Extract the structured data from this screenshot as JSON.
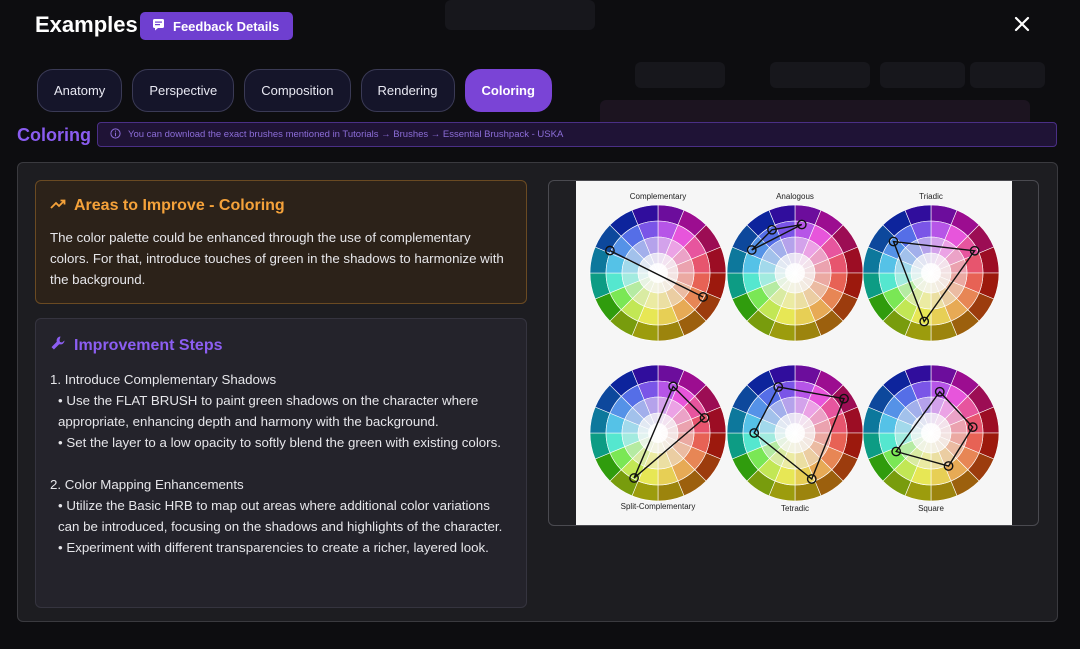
{
  "header": {
    "title": "Examples",
    "feedback_label": "Feedback Details",
    "close_icon": "close-icon"
  },
  "tabs": [
    {
      "label": "Anatomy",
      "active": false
    },
    {
      "label": "Perspective",
      "active": false
    },
    {
      "label": "Composition",
      "active": false
    },
    {
      "label": "Rendering",
      "active": false
    },
    {
      "label": "Coloring",
      "active": true
    }
  ],
  "section": {
    "title": "Coloring",
    "info": "You can download the exact brushes mentioned in Tutorials → Brushes → Essential Brushpack - USKA"
  },
  "improve": {
    "title": "Areas to Improve - Coloring",
    "body": "The color palette could be enhanced through the use of complementary colors. For that, introduce touches of green in the shadows to harmonize with the background."
  },
  "steps": {
    "title": "Improvement Steps",
    "s1_title": "1. Introduce Complementary Shadows",
    "s1_b1": "• Use the FLAT BRUSH to paint green shadows on the character where appropriate, enhancing depth and harmony with the background.",
    "s1_b2": "• Set the layer to a low opacity to softly blend the green with existing colors.",
    "s2_title": "2. Color Mapping Enhancements",
    "s2_b1": "• Utilize the Basic HRB to map out areas where additional color variations can be introduced, focusing on the shadows and highlights of the character.",
    "s2_b2": "• Experiment with different transparencies to create a richer, layered look."
  },
  "wheels": {
    "complementary": "Complementary",
    "analogous": "Analogous",
    "triadic": "Triadic",
    "split": "Split-Complementary",
    "tetradic": "Tetradic",
    "square": "Square"
  },
  "colors": {
    "accent": "#7a44d6",
    "warning": "#f5a23a",
    "panel": "#1d1d21"
  }
}
